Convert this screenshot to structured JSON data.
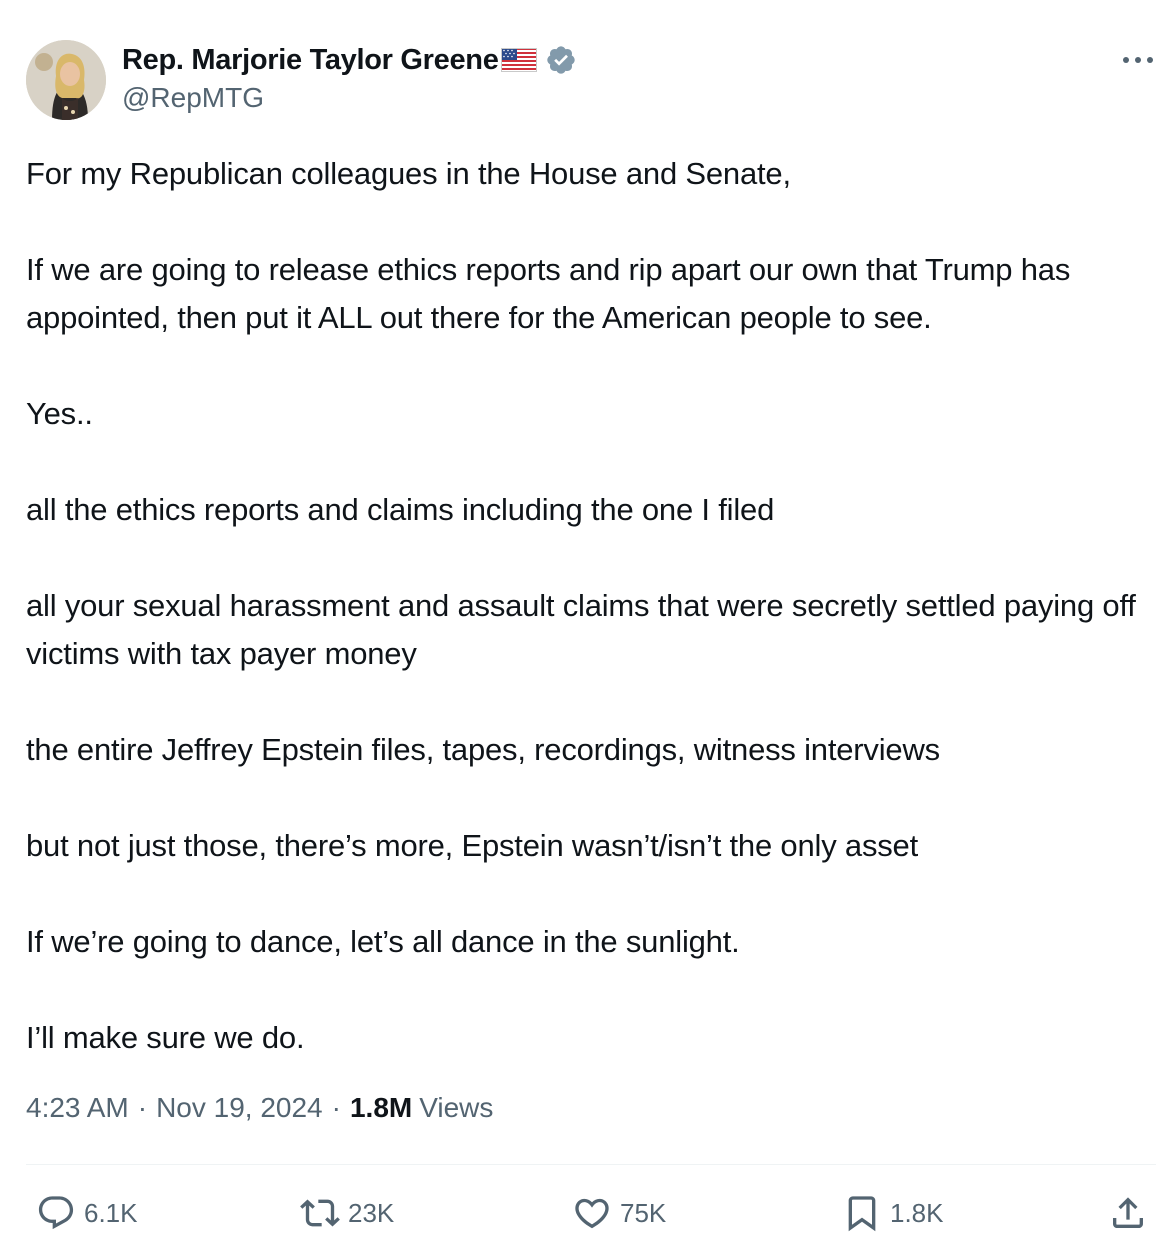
{
  "author": {
    "name": "Rep. Marjorie Taylor Greene",
    "handle": "@RepMTG",
    "avatar_icon": "profile-photo",
    "flag_icon": "us-flag-icon",
    "verified_icon": "verified-badge-icon",
    "verified_color": "#829aab"
  },
  "tweet": {
    "paragraphs": [
      "For my Republican colleagues in the House and Senate,",
      "If we are going to release ethics reports and rip apart our own that Trump has appointed, then put it ALL out there for the American people to see.",
      "Yes..",
      "all the ethics reports and claims including the one I filed",
      "all your sexual harassment and assault claims that were secretly settled paying off victims with tax payer money",
      "the entire Jeffrey Epstein files, tapes, recordings, witness interviews",
      "but not just those, there’s more, Epstein wasn’t/isn’t the only asset",
      "If we’re going to dance, let’s all dance in the sunlight.",
      "I’ll make sure we do."
    ]
  },
  "meta": {
    "time": "4:23 AM",
    "separator": "·",
    "date": "Nov 19, 2024",
    "views_count": "1.8M",
    "views_label": "Views"
  },
  "actions": {
    "replies": "6.1K",
    "reposts": "23K",
    "likes": "75K",
    "bookmarks": "1.8K"
  },
  "colors": {
    "text": "#0f1419",
    "secondary": "#536471",
    "divider": "#eff3f4"
  }
}
